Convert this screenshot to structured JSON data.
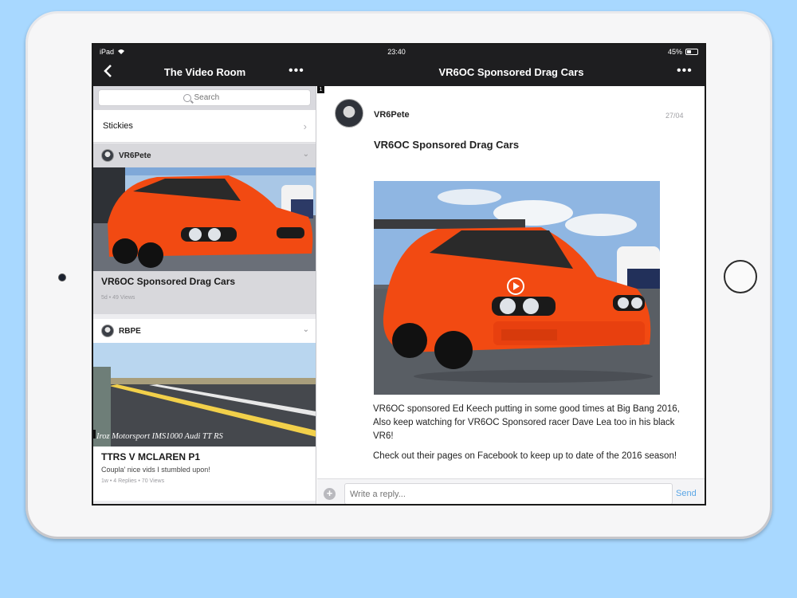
{
  "status_bar": {
    "device": "iPad",
    "time": "23:40",
    "battery": "45%",
    "battery_level": 0.45
  },
  "left_nav": {
    "back": "<",
    "title": "The Video Room",
    "more": "•••"
  },
  "right_nav": {
    "title": "VR6OC Sponsored Drag Cars",
    "more": "•••"
  },
  "search": {
    "placeholder": "Search"
  },
  "stickies": {
    "label": "Stickies",
    "chevron": "›"
  },
  "threads": [
    {
      "author": "VR6Pete",
      "title": "VR6OC Sponsored Drag Cars",
      "meta": "5d • 49 Views",
      "chevron": "⌄"
    },
    {
      "author": "RBPE",
      "title": "TTRS V MCLAREN P1",
      "subtitle": "Coupla' nice vids I stumbled upon!",
      "meta": "1w • 4 Replies • 70 Views",
      "thumb_caption": "Iroz Motorsport IMS1000 Audi TT RS",
      "chevron": "⌄"
    }
  ],
  "post": {
    "page_badge": "1",
    "author": "VR6Pete",
    "date": "27/04",
    "title": "VR6OC Sponsored Drag Cars",
    "paragraphs": [
      " VR6OC sponsored Ed Keech putting in some good times at Big Bang 2016, Also keep watching for VR6OC Sponsored racer Dave Lea too in his black VR6!",
      " Check out their pages on Facebook to keep up to date of the 2016 season!"
    ]
  },
  "reply": {
    "placeholder": "Write a reply...",
    "send": "Send",
    "plus": "+"
  },
  "icons": [
    "back-icon",
    "more-icon",
    "search-icon",
    "chevron-right-icon",
    "chevron-down-icon",
    "play-icon",
    "plus-icon",
    "wifi-icon",
    "battery-icon"
  ]
}
